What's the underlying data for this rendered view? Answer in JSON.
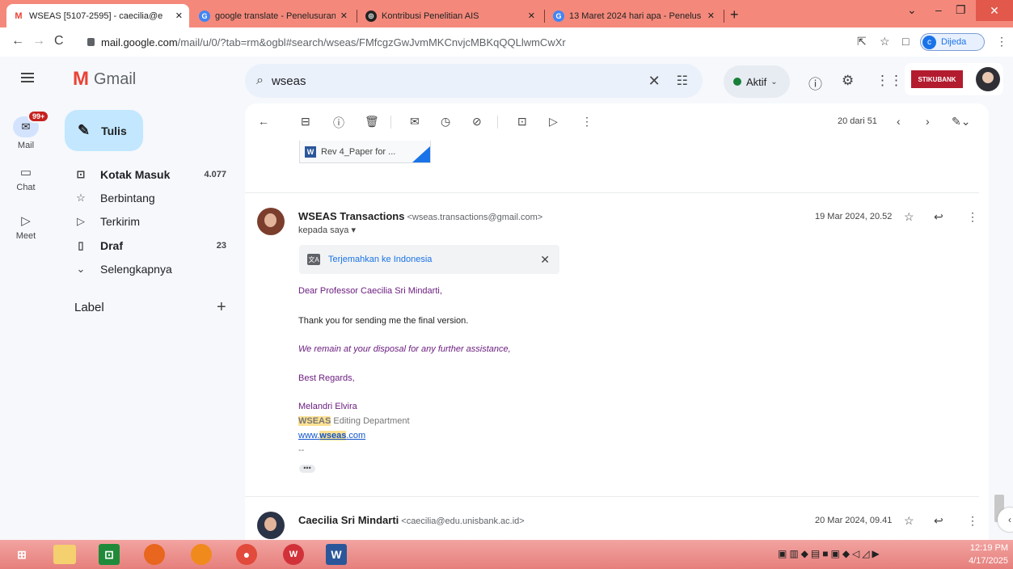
{
  "browser": {
    "tabs": [
      {
        "title": "WSEAS [5107-2595] - caecilia@e",
        "icon": "gmail-icon"
      },
      {
        "title": "google translate - Penelusuran G",
        "icon": "google-icon"
      },
      {
        "title": "Kontribusi Penelitian AIS",
        "icon": "site-icon"
      },
      {
        "title": "13 Maret 2024 hari apa - Penelus",
        "icon": "google-icon"
      }
    ],
    "url_host": "mail.google.com",
    "url_path": "/mail/u/0/?tab=rm&ogbl#search/wseas/FMfcgzGwJvmMKCnvjcMBKqQQLlwmCwXr",
    "profile_initial": "c",
    "profile_label": "Dijeda"
  },
  "gmail": {
    "logo_text": "Gmail",
    "search_value": "wseas",
    "status_label": "Aktif",
    "account_badge": "STIKUBANK"
  },
  "rail": {
    "mail_label": "Mail",
    "mail_badge": "99+",
    "chat_label": "Chat",
    "meet_label": "Meet"
  },
  "sidebar": {
    "compose_label": "Tulis",
    "items": [
      {
        "label": "Kotak Masuk",
        "count": "4.077"
      },
      {
        "label": "Berbintang",
        "count": ""
      },
      {
        "label": "Terkirim",
        "count": ""
      },
      {
        "label": "Draf",
        "count": "23"
      },
      {
        "label": "Selengkapnya",
        "count": ""
      }
    ],
    "label_header": "Label"
  },
  "toolbar": {
    "pager_text": "20 dari 51"
  },
  "thread": {
    "attachment_name": "Rev 4_Paper for ...",
    "message1": {
      "sender_name": "WSEAS Transactions",
      "sender_email": "<wseas.transactions@gmail.com>",
      "recipient": "kepada saya",
      "date": "19 Mar 2024, 20.52",
      "translate_label": "Terjemahkan ke Indonesia",
      "greeting": "Dear Professor Caecilia Sri Mindarti,",
      "line1": "Thank you for sending me the final version.",
      "line2": "We remain at your disposal for any further assistance,",
      "closing": "Best Regards,",
      "sig_name": "Melandri Elvira",
      "sig_org_hl": "WSEAS",
      "sig_org_rest": " Editing Department",
      "sig_url_pre": "www.",
      "sig_url_hl": "wseas",
      "sig_url_post": ".com",
      "sig_dash": "--"
    },
    "message2": {
      "sender_name": "Caecilia Sri Mindarti",
      "sender_email": "<caecilia@edu.unisbank.ac.id>",
      "date": "20 Mar 2024, 09.41"
    }
  },
  "taskbar": {
    "time": "12:19 PM",
    "date": "4/17/2025"
  }
}
